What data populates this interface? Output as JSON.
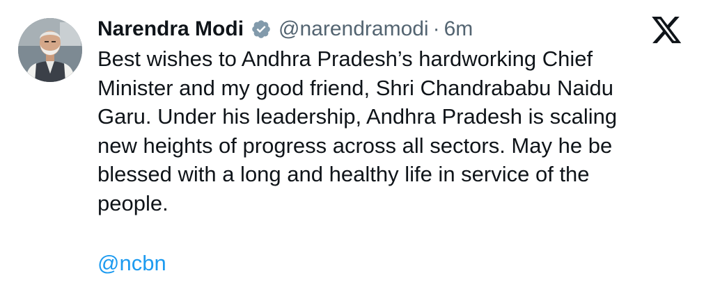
{
  "author": {
    "name": "Narendra Modi",
    "handle": "@narendramodi",
    "separator": "·",
    "time": "6m",
    "verified_badge": "verified-badge-icon",
    "avatar": "profile-photo"
  },
  "platform_logo": "x-logo-icon",
  "tweet": {
    "text": "Best wishes to Andhra Pradesh’s hardworking Chief\nMinister and my good friend, Shri Chandrababu Naidu\nGaru. Under his leadership, Andhra Pradesh is scaling\nnew heights of progress across all sectors. May he be\nblessed with a long and healthy life in service of the\npeople.",
    "mention": "@ncbn"
  },
  "colors": {
    "text": "#0f1419",
    "secondary": "#536471",
    "link": "#1d9bf0",
    "badge": "#829aab"
  }
}
